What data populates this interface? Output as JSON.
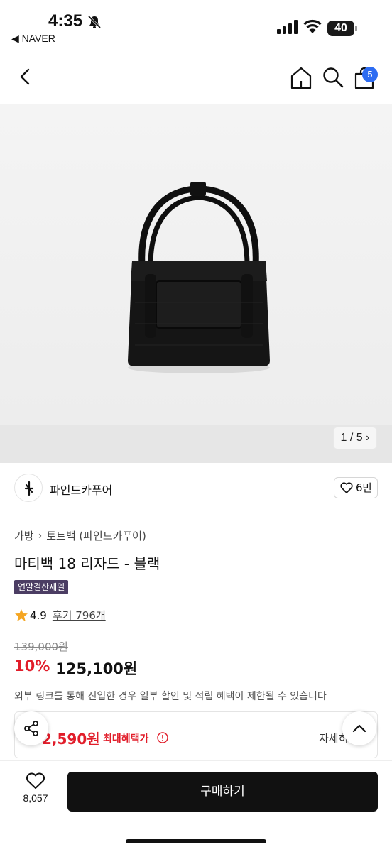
{
  "status": {
    "time": "4:35",
    "back_app": "◀ NAVER",
    "battery": "40"
  },
  "nav": {
    "cart_count": "5"
  },
  "hero": {
    "page_indicator": "1 / 5 ›"
  },
  "store": {
    "name": "파인드카푸어",
    "likes": "6만"
  },
  "breadcrumb": {
    "items": [
      "가방",
      "토트백 (파인드카푸어)"
    ],
    "separator": "›"
  },
  "product": {
    "title": "마티백 18 리자드 - 블랙",
    "promo_badge": "연말결산세일",
    "rating": "4.9",
    "review_link": "후기 796개",
    "original_price": "139,000원",
    "discount": "10%",
    "sale_price": "125,100원",
    "notice": "외부 링크를 통해 진입한 경우 일부 할인 및 적립 혜택이 제한될 수 있습니다"
  },
  "benefit": {
    "price": "2,590원",
    "label": "최대혜택가",
    "detail": "자세히"
  },
  "bottom": {
    "wish_count": "8,057",
    "buy_label": "구매하기"
  },
  "icons": [
    "bell-slash-icon",
    "signal-icon",
    "wifi-icon",
    "back-arrow-icon",
    "home-icon",
    "search-icon",
    "cart-icon",
    "heart-icon",
    "star-icon",
    "info-icon",
    "share-icon",
    "chevron-up-icon"
  ],
  "colors": {
    "accent_red": "#e11d2a",
    "badge_purple": "#4b3d63",
    "cart_badge_blue": "#2d6cf2",
    "buy_button": "#111111"
  }
}
